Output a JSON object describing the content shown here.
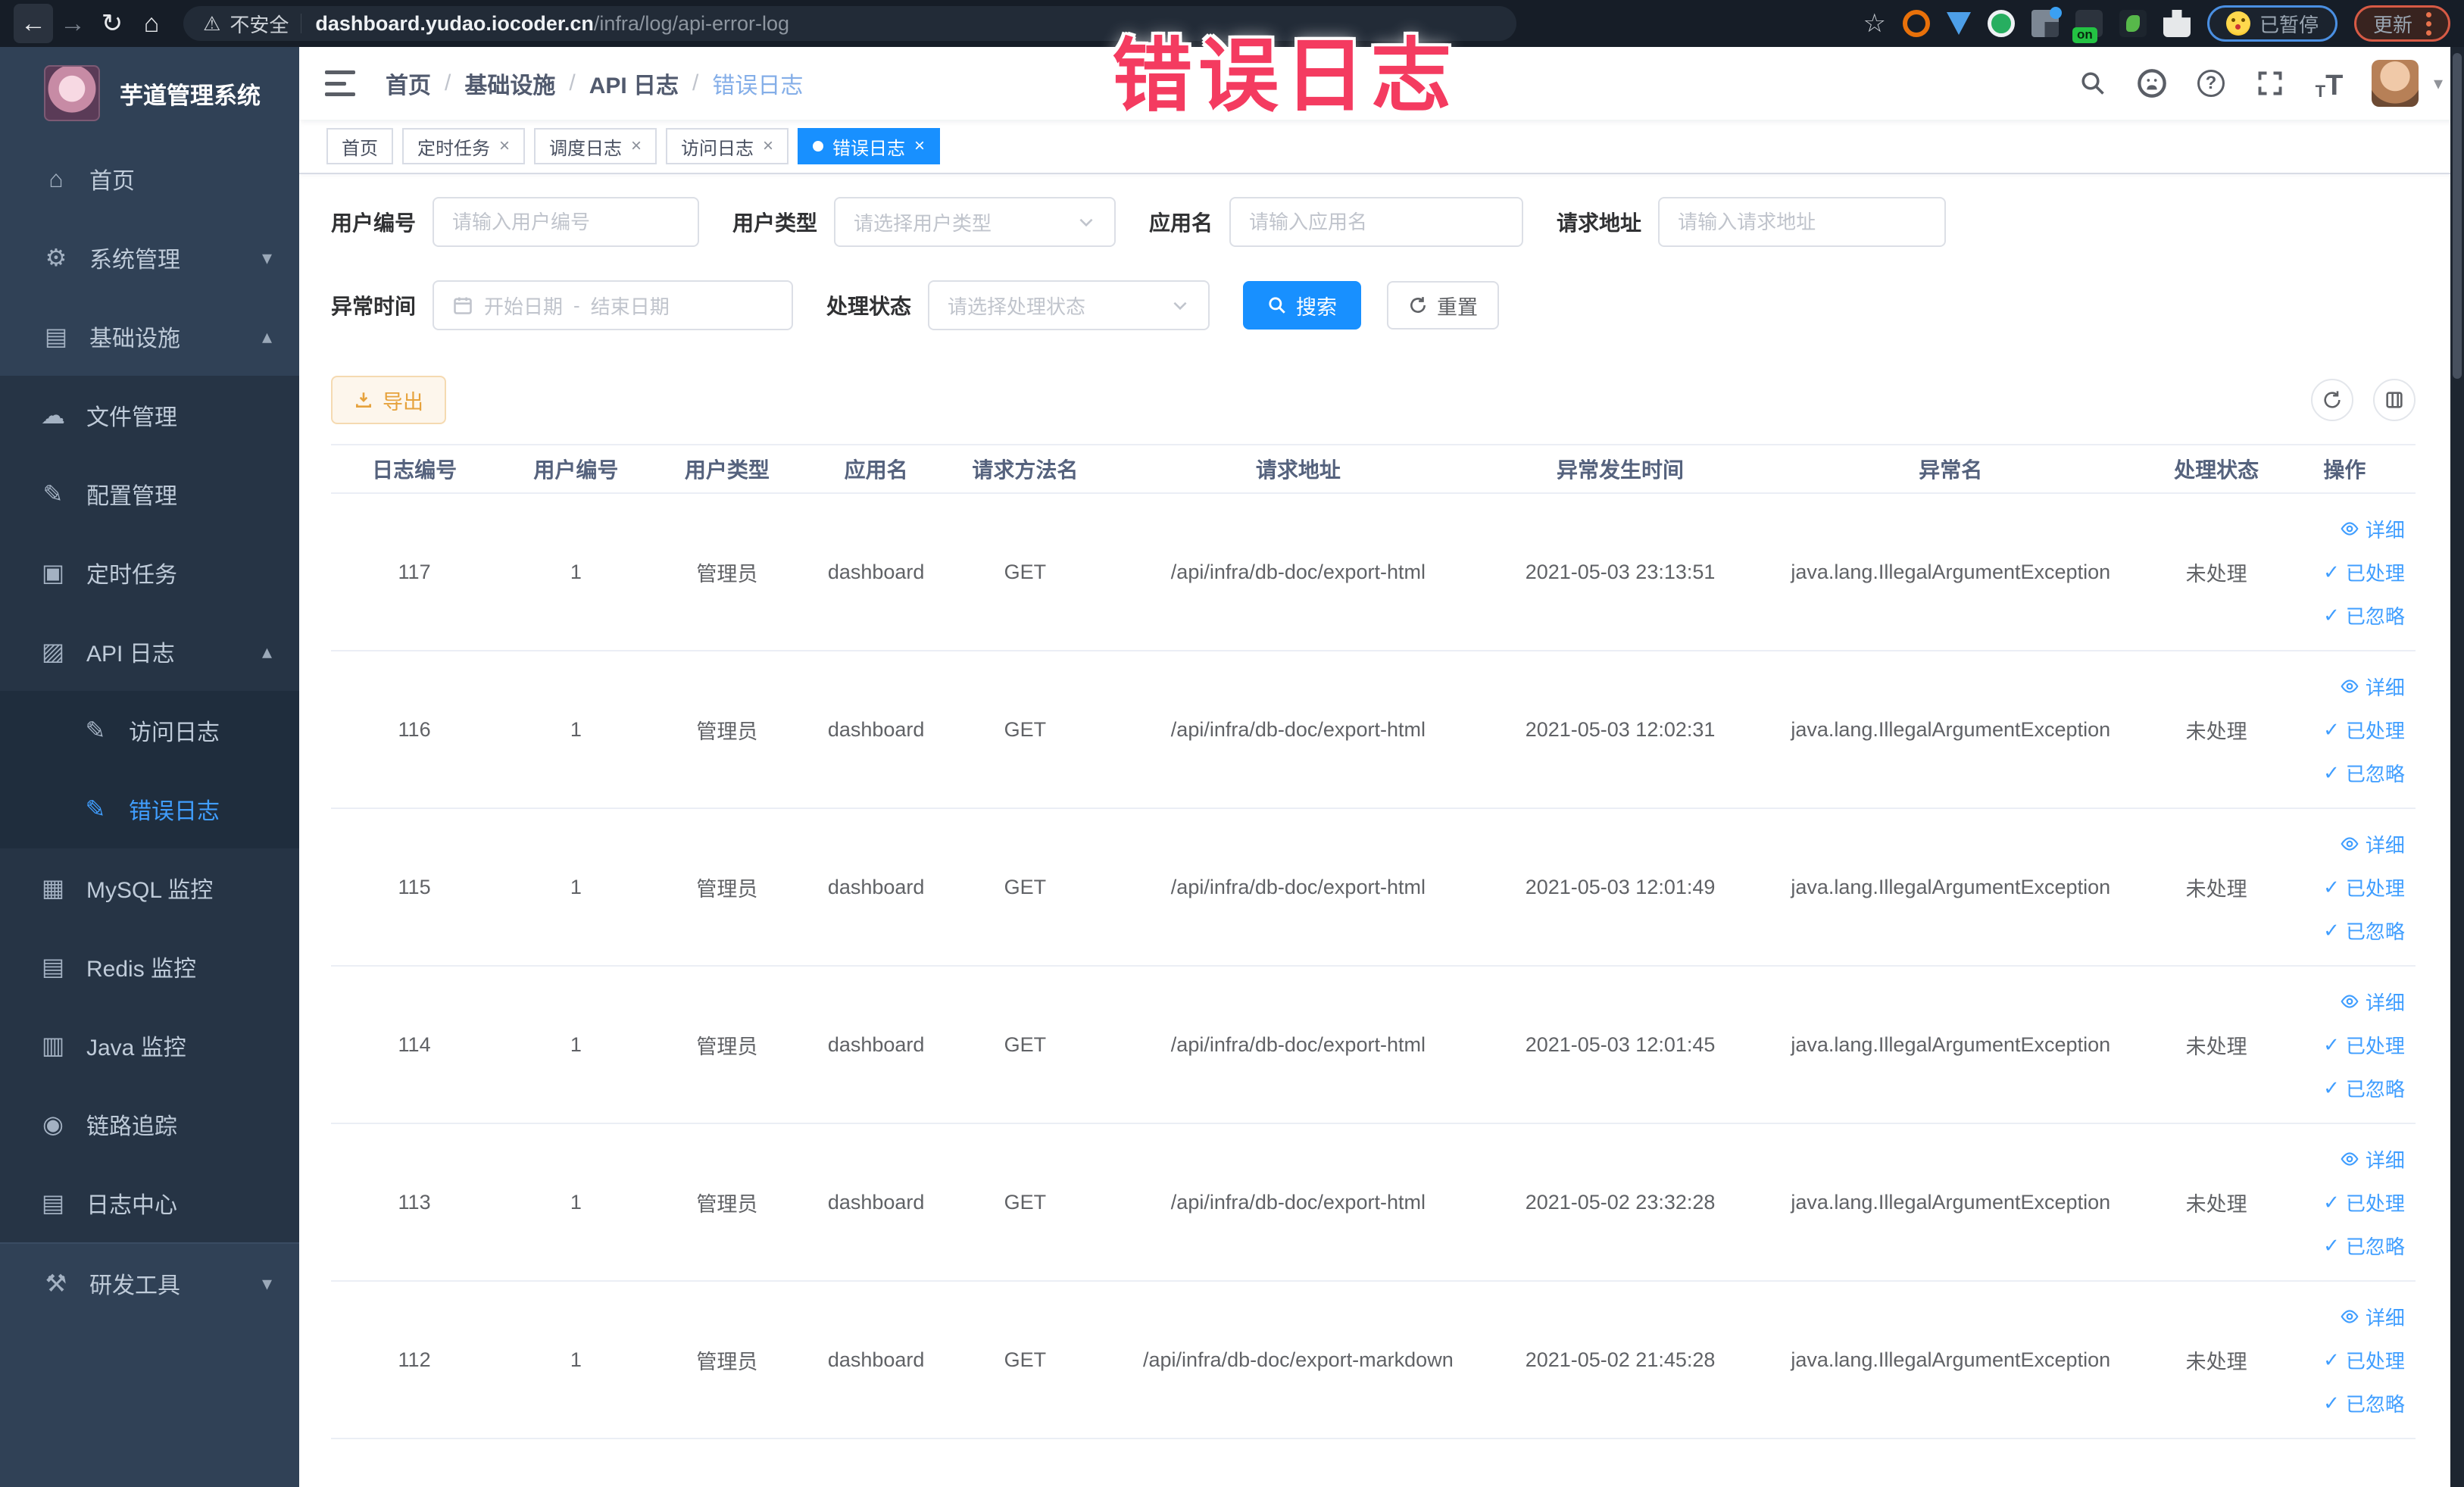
{
  "overlay_title": "错误日志",
  "browser": {
    "security": "不安全",
    "host": "dashboard.yudao.iocoder.cn",
    "path": "/infra/log/api-error-log",
    "paused": "已暂停",
    "update": "更新",
    "on_badge": "on"
  },
  "icons": {
    "back": "←",
    "forward": "→",
    "reload": "↻",
    "home": "⌂",
    "star": "☆",
    "warning": "⚠",
    "caret": "▾",
    "question": "?",
    "font_t": "T",
    "check": "✓",
    "close": "×",
    "chevron_up": "▴",
    "chevron_down": "▾",
    "home_menu": "⌂",
    "gear": "⚙",
    "infra": "▤",
    "cloud": "☁",
    "edit": "✎",
    "task": "▣",
    "apilog": "▨",
    "mysql": "▦",
    "redis": "▤",
    "java": "▥",
    "trace": "◉",
    "logcenter": "▤",
    "devtools": "⚒",
    "range_sep": "-"
  },
  "sidebar": {
    "title": "芋道管理系统",
    "items": [
      {
        "label": "首页"
      },
      {
        "label": "系统管理"
      },
      {
        "label": "基础设施"
      },
      {
        "label": "文件管理"
      },
      {
        "label": "配置管理"
      },
      {
        "label": "定时任务"
      },
      {
        "label": "API 日志"
      },
      {
        "label": "访问日志"
      },
      {
        "label": "错误日志"
      },
      {
        "label": "MySQL 监控"
      },
      {
        "label": "Redis 监控"
      },
      {
        "label": "Java 监控"
      },
      {
        "label": "链路追踪"
      },
      {
        "label": "日志中心"
      },
      {
        "label": "研发工具"
      }
    ]
  },
  "breadcrumb": {
    "separator": "/",
    "items": [
      "首页",
      "基础设施",
      "API 日志",
      "错误日志"
    ]
  },
  "tags": [
    {
      "label": "首页"
    },
    {
      "label": "定时任务"
    },
    {
      "label": "调度日志"
    },
    {
      "label": "访问日志"
    },
    {
      "label": "错误日志"
    }
  ],
  "filters": {
    "user_id_label": "用户编号",
    "user_id_placeholder": "请输入用户编号",
    "user_type_label": "用户类型",
    "user_type_placeholder": "请选择用户类型",
    "app_name_label": "应用名",
    "app_name_placeholder": "请输入应用名",
    "request_url_label": "请求地址",
    "request_url_placeholder": "请输入请求地址",
    "exception_time_label": "异常时间",
    "start_placeholder": "开始日期",
    "end_placeholder": "结束日期",
    "process_status_label": "处理状态",
    "process_status_placeholder": "请选择处理状态",
    "search_label": "搜索",
    "reset_label": "重置"
  },
  "toolbar": {
    "export_label": "导出"
  },
  "table": {
    "headers": [
      "日志编号",
      "用户编号",
      "用户类型",
      "应用名",
      "请求方法名",
      "请求地址",
      "异常发生时间",
      "异常名",
      "处理状态",
      "操作"
    ],
    "actions": {
      "detail": "详细",
      "processed": "已处理",
      "ignored": "已忽略"
    },
    "rows": [
      {
        "log_id": "117",
        "user_id": "1",
        "user_type": "管理员",
        "app": "dashboard",
        "method": "GET",
        "url": "/api/infra/db-doc/export-html",
        "time": "2021-05-03 23:13:51",
        "exception": "java.lang.IllegalArgumentException",
        "status": "未处理"
      },
      {
        "log_id": "116",
        "user_id": "1",
        "user_type": "管理员",
        "app": "dashboard",
        "method": "GET",
        "url": "/api/infra/db-doc/export-html",
        "time": "2021-05-03 12:02:31",
        "exception": "java.lang.IllegalArgumentException",
        "status": "未处理"
      },
      {
        "log_id": "115",
        "user_id": "1",
        "user_type": "管理员",
        "app": "dashboard",
        "method": "GET",
        "url": "/api/infra/db-doc/export-html",
        "time": "2021-05-03 12:01:49",
        "exception": "java.lang.IllegalArgumentException",
        "status": "未处理"
      },
      {
        "log_id": "114",
        "user_id": "1",
        "user_type": "管理员",
        "app": "dashboard",
        "method": "GET",
        "url": "/api/infra/db-doc/export-html",
        "time": "2021-05-03 12:01:45",
        "exception": "java.lang.IllegalArgumentException",
        "status": "未处理"
      },
      {
        "log_id": "113",
        "user_id": "1",
        "user_type": "管理员",
        "app": "dashboard",
        "method": "GET",
        "url": "/api/infra/db-doc/export-html",
        "time": "2021-05-02 23:32:28",
        "exception": "java.lang.IllegalArgumentException",
        "status": "未处理"
      },
      {
        "log_id": "112",
        "user_id": "1",
        "user_type": "管理员",
        "app": "dashboard",
        "method": "GET",
        "url": "/api/infra/db-doc/export-markdown",
        "time": "2021-05-02 21:45:28",
        "exception": "java.lang.IllegalArgumentException",
        "status": "未处理"
      }
    ]
  },
  "colors": {
    "accent": "#1890ff",
    "link": "#409eff",
    "warning": "#e6a23c",
    "overlay_pink": "#f43b60",
    "sidebar_bg": "#304156"
  }
}
